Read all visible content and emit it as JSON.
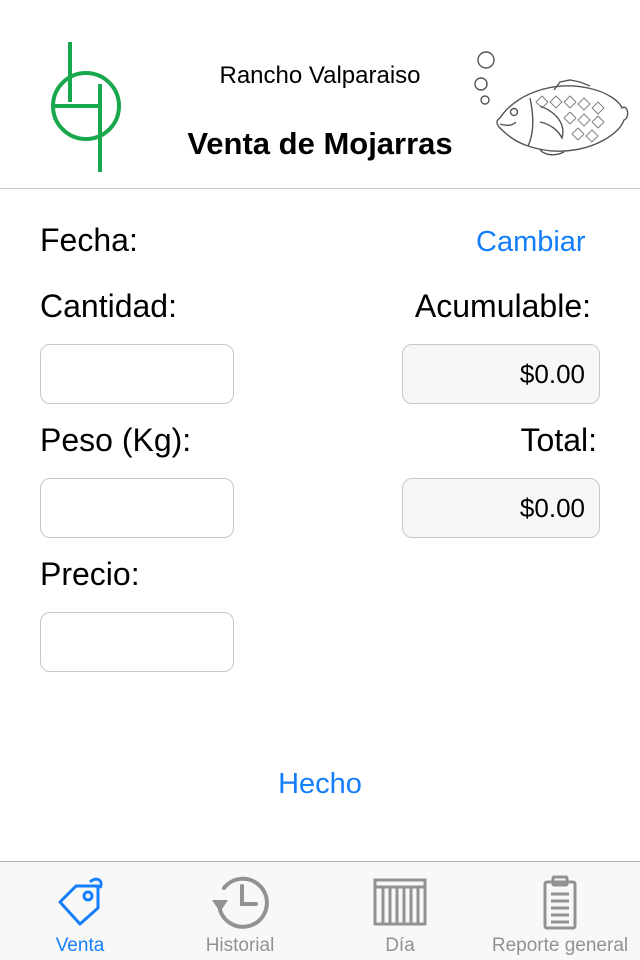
{
  "header": {
    "ranch_name": "Rancho Valparaiso",
    "title": "Venta de Mojarras"
  },
  "form": {
    "fecha_label": "Fecha:",
    "cambiar_label": "Cambiar",
    "cantidad_label": "Cantidad:",
    "cantidad_value": "",
    "acumulable_label": "Acumulable:",
    "acumulable_value": "$0.00",
    "peso_label": "Peso (Kg):",
    "peso_value": "",
    "total_label": "Total:",
    "total_value": "$0.00",
    "precio_label": "Precio:",
    "precio_value": "",
    "hecho_label": "Hecho"
  },
  "tabs": [
    {
      "label": "Venta",
      "icon": "price-tag-icon",
      "active": true
    },
    {
      "label": "Historial",
      "icon": "history-clock-icon",
      "active": false
    },
    {
      "label": "Día",
      "icon": "calendar-grid-icon",
      "active": false
    },
    {
      "label": "Reporte general",
      "icon": "clipboard-icon",
      "active": false
    }
  ],
  "colors": {
    "accent": "#147efb",
    "logo_green": "#1aa84f",
    "inactive_tab": "#929292",
    "readonly_bg": "#f7f7f7",
    "border": "#c8c7cc"
  }
}
